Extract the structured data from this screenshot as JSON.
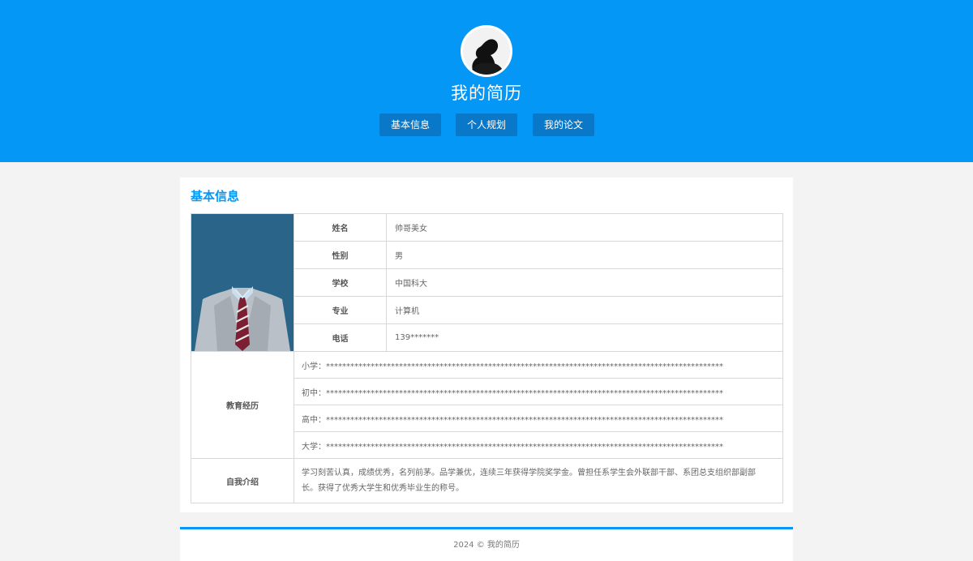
{
  "header": {
    "title": "我的简历",
    "nav": [
      {
        "label": "基本信息"
      },
      {
        "label": "个人规划"
      },
      {
        "label": "我的论文"
      }
    ],
    "colors": {
      "brand": "#0497f6",
      "nav_button": "#0a78c8"
    }
  },
  "basic_info": {
    "section_title": "基本信息",
    "fields": [
      {
        "label": "姓名",
        "value": "帅哥美女"
      },
      {
        "label": "性别",
        "value": "男"
      },
      {
        "label": "学校",
        "value": "中国科大"
      },
      {
        "label": "专业",
        "value": "计算机"
      },
      {
        "label": "电话",
        "value": "139*******"
      }
    ],
    "education": {
      "label": "教育经历",
      "items": [
        "小学：**************************************************************************************************",
        "初中：**************************************************************************************************",
        "高中：**************************************************************************************************",
        "大学：**************************************************************************************************"
      ]
    },
    "self_intro": {
      "label": "自我介绍",
      "text": "学习刻苦认真，成绩优秀，名列前茅。品学兼优，连续三年获得学院奖学金。曾担任系学生会外联部干部、系团总支组织部副部长。获得了优秀大学生和优秀毕业生的称号。"
    }
  },
  "footer": {
    "text": "2024 © 我的简历"
  }
}
